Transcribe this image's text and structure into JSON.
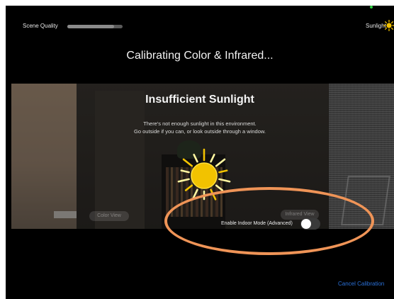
{
  "header": {
    "scene_quality_label": "Scene Quality",
    "scene_quality_level": 0.85,
    "sunlight_label": "Sunlight"
  },
  "title": "Calibrating Color & Infrared...",
  "alert": {
    "title": "Insufficient Sunlight",
    "line1": "There's not enough sunlight in this environment.",
    "line2": "Go outside if you can, or look outside through a window."
  },
  "views": {
    "color_label": "Color View",
    "infrared_label": "Infrared View"
  },
  "indoor_mode": {
    "label": "Enable Indoor Mode (Advanced)",
    "enabled": false
  },
  "footer": {
    "cancel_label": "Cancel Calibration"
  },
  "colors": {
    "background": "#000000",
    "sun_fill": "#f2c200",
    "sun_ray_light": "#fff6a0",
    "highlight_annotation": "#ef9457",
    "cancel_link": "#2b71d9",
    "status_dot": "#2ecc40"
  },
  "icons": {
    "sunlight_indicator": "sun-icon",
    "alert_sun": "sun-icon"
  }
}
